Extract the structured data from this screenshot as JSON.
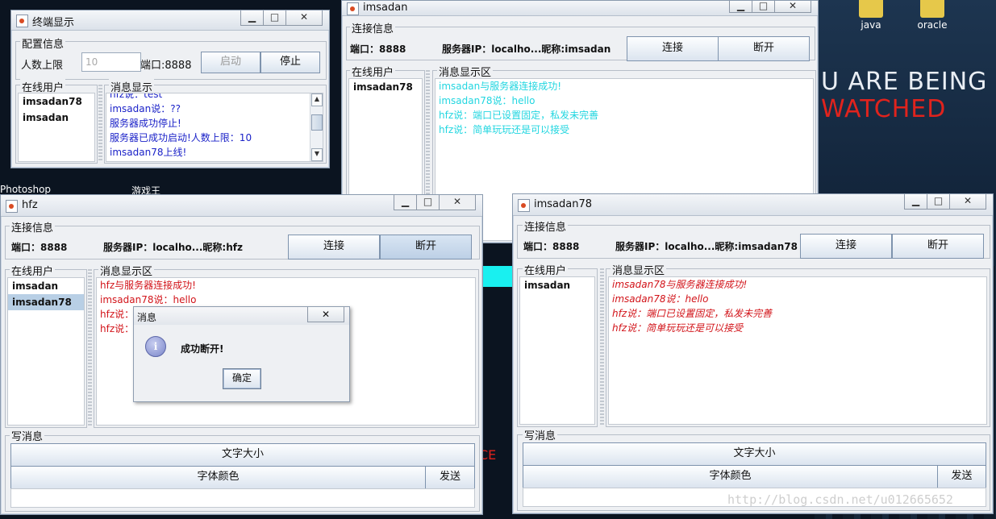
{
  "desktop": {
    "icons": [
      {
        "label": "java"
      },
      {
        "label": "oracle"
      },
      {
        "label": "Photoshop"
      },
      {
        "label": "游戏王"
      }
    ],
    "slogan_line1": "U ARE BEING",
    "slogan_line2": "WATCHED",
    "watermark": "http://blog.csdn.net/u012665652"
  },
  "server_window": {
    "title": "终端显示",
    "config_legend": "配置信息",
    "max_users_label": "人数上限",
    "max_users_value": "10",
    "port_label": "端口:8888",
    "start_button": "启动",
    "stop_button": "停止",
    "online_legend": "在线用户",
    "online_users": [
      "imsadan78",
      "imsadan"
    ],
    "messages_legend": "消息显示",
    "messages": [
      "hfz说：test",
      "imsadan说：??",
      "服务器成功停止!",
      "服务器已成功启动!人数上限：10",
      "imsadan78上线!"
    ]
  },
  "client_imsadan": {
    "title": "imsadan",
    "conn_legend": "连接信息",
    "port_label": "端口：8888",
    "server_label": "服务器IP：localho...昵称:imsadan",
    "connect_button": "连接",
    "disconnect_button": "断开",
    "online_legend": "在线用户",
    "online_users": [
      "imsadan78"
    ],
    "messages_legend": "消息显示区",
    "messages": [
      "imsadan与服务器连接成功!",
      "imsadan78说：hello",
      "hfz说：端口已设置固定，私发未完善",
      "hfz说：简单玩玩还是可以接受"
    ]
  },
  "client_hfz": {
    "title": "hfz",
    "conn_legend": "连接信息",
    "port_label": "端口：8888",
    "server_label": "服务器IP：localho...昵称:hfz",
    "connect_button": "连接",
    "disconnect_button": "断开",
    "online_legend": "在线用户",
    "online_users": [
      "imsadan",
      "imsadan78"
    ],
    "messages_legend": "消息显示区",
    "messages": [
      "hfz与服务器连接成功!",
      "imsadan78说：hello",
      "hfz说：端口已设置固定，私发未完善",
      "hfz说：简单玩玩还是可以接受"
    ],
    "write_legend": "写消息",
    "font_size_button": "文字大小",
    "font_color_button": "字体颜色",
    "send_button": "发送"
  },
  "client_imsadan78": {
    "title": "imsadan78",
    "conn_legend": "连接信息",
    "port_label": "端口：8888",
    "server_label": "服务器IP：localho...昵称:imsadan78",
    "connect_button": "连接",
    "disconnect_button": "断开",
    "online_legend": "在线用户",
    "online_users": [
      "imsadan"
    ],
    "messages_legend": "消息显示区",
    "messages": [
      "imsadan78与服务器连接成功!",
      "imsadan78说：hello",
      "hfz说：端口已设置固定，私发未完善",
      "hfz说：简单玩玩还是可以接受"
    ],
    "write_legend": "写消息",
    "font_size_button": "文字大小",
    "font_color_button": "字体颜色",
    "send_button": "发送"
  },
  "dialog": {
    "title": "消息",
    "message": "成功断开!",
    "ok_button": "确定",
    "close_glyph": "✕"
  },
  "window_glyphs": {
    "minimize": "▁",
    "maximize": "□",
    "close": "✕"
  },
  "colors": {
    "server_msg": "#1b22c8",
    "imsadan_msg": "#22d6e0",
    "hfz_msg": "#d2141a",
    "imsadan78_msg": "#d2141a"
  }
}
